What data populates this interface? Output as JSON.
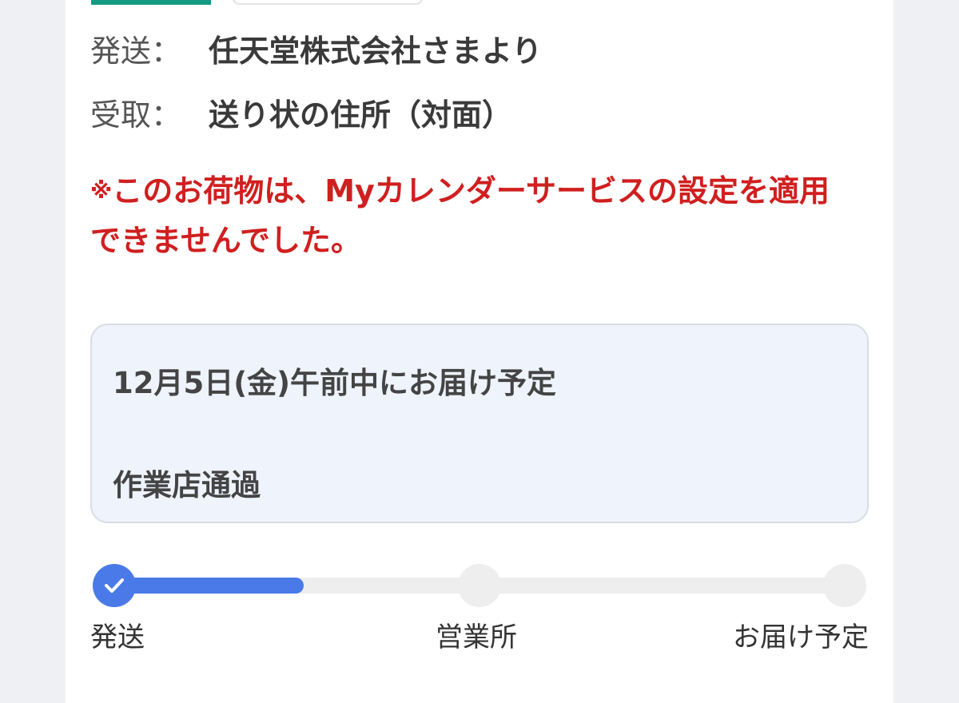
{
  "shipment": {
    "sender_label": "発送：",
    "sender_value": "任天堂株式会社さまより",
    "receive_label": "受取：",
    "receive_value": "送り状の住所（対面）"
  },
  "notice": {
    "mark": "※",
    "text": "このお荷物は、Myカレンダーサービスの設定を適用できませんでした。",
    "color": "#d01f1f"
  },
  "status": {
    "delivery_date": "12月5日(金)午前中にお届け予定",
    "state": "作業店通過"
  },
  "progress": {
    "steps": [
      "発送",
      "営業所",
      "お届け予定"
    ],
    "completed_index": 0,
    "fill_fraction": 0.26,
    "accent_color": "#4a7ae8",
    "completed_icon": "check-icon"
  }
}
